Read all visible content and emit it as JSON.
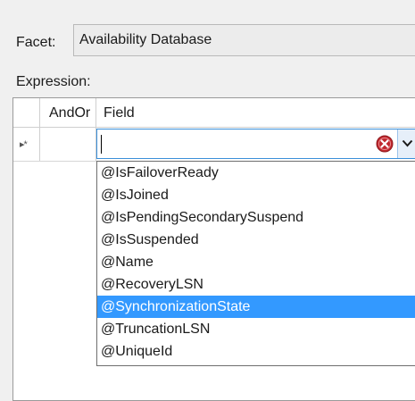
{
  "facet": {
    "label": "Facet:",
    "value": "Availability Database"
  },
  "expression": {
    "label": "Expression:"
  },
  "grid": {
    "columns": [
      "AndOr",
      "Field"
    ],
    "new_row_marker": "▸*",
    "field_value": ""
  },
  "field_list": {
    "items": [
      "@IsFailoverReady",
      "@IsJoined",
      "@IsPendingSecondarySuspend",
      "@IsSuspended",
      "@Name",
      "@RecoveryLSN",
      "@SynchronizationState",
      "@TruncationLSN",
      "@UniqueId"
    ],
    "selected_index": 6
  },
  "colors": {
    "selection": "#3399ff",
    "clear_icon": "#c0272d",
    "focus_border": "#3b8fd9"
  },
  "icons": {
    "clear": "clear-icon",
    "dropdown": "chevron-down-icon"
  }
}
